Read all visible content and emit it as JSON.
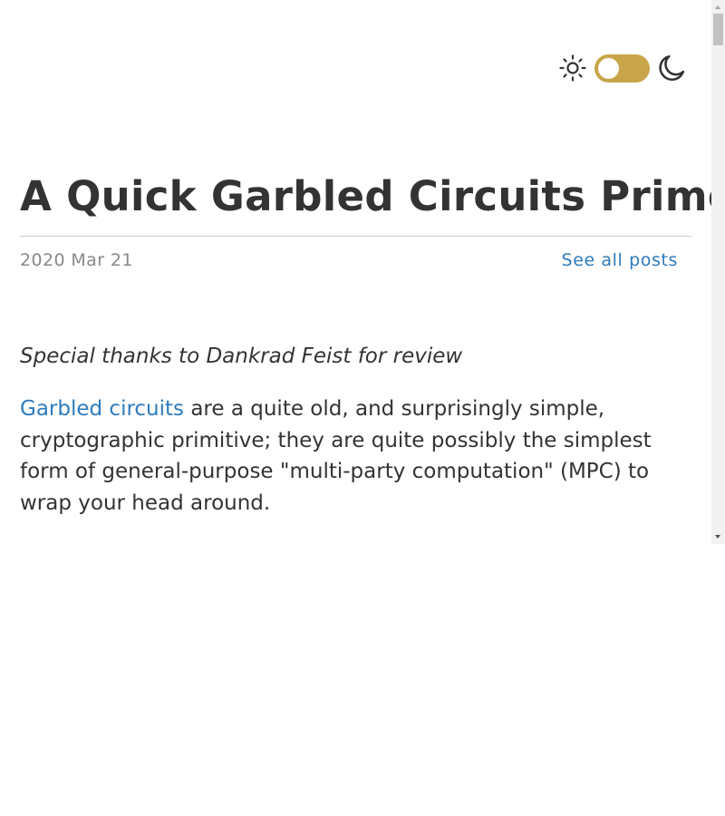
{
  "theme_toggle": {
    "light_icon": "sun-icon",
    "dark_icon": "moon-icon",
    "state": "light",
    "track_color": "#c8a549"
  },
  "post": {
    "title": "A Quick Garbled Circuits Primer",
    "date": "2020 Mar 21",
    "all_posts_label": "See all posts",
    "thanks": "Special thanks to Dankrad Feist for review",
    "intro_link": "Garbled circuits",
    "intro_text": " are a quite old, and surprisingly simple, cryptographic primitive; they are quite possibly the simplest form of general-purpose \"multi-party computation\" (MPC) to wrap your head around."
  },
  "colors": {
    "text": "#333333",
    "link": "#2e7bbd",
    "muted": "#888888",
    "rule": "#cccccc"
  }
}
